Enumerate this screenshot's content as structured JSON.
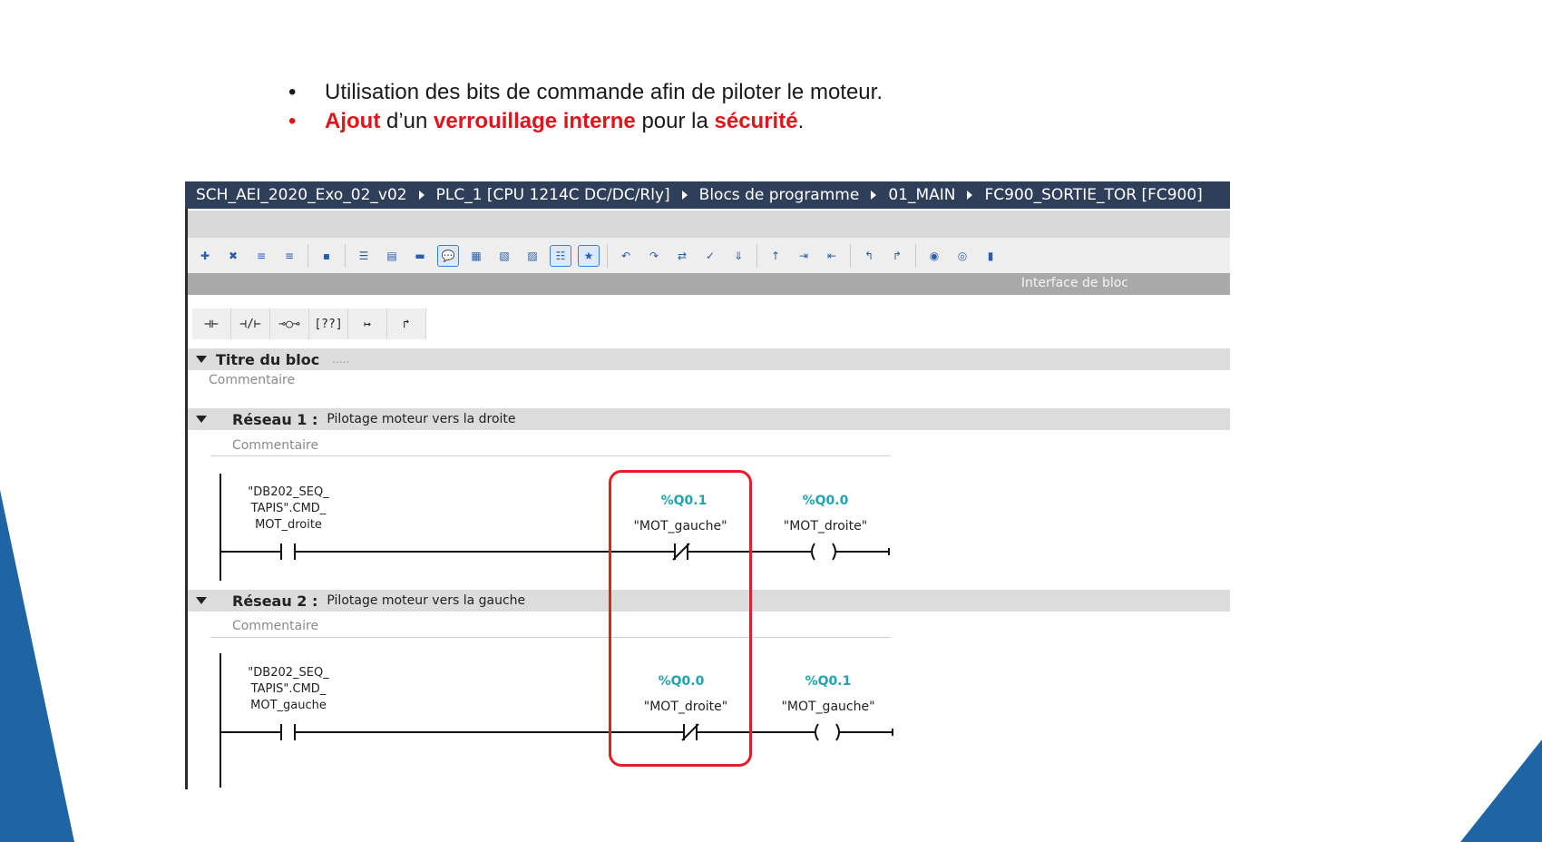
{
  "slide": {
    "bullet1": "Utilisation des bits de commande afin de piloter le moteur.",
    "bullet2": {
      "w1": "Ajout",
      "t1": "d’un",
      "w2": "verrouillage interne",
      "t2": "pour la",
      "w3": "sécurité",
      "t3": "."
    },
    "bullet_char": "•",
    "colors": {
      "highlight": "#e0141b",
      "decor": "#1f64a3"
    }
  },
  "breadcrumb": [
    "SCH_AEI_2020_Exo_02_v02",
    "PLC_1 [CPU 1214C DC/DC/Rly]",
    "Blocs de programme",
    "01_MAIN",
    "FC900_SORTIE_TOR [FC900]"
  ],
  "interface_label": "Interface de bloc",
  "lad_tools": [
    "⊣⊢",
    "⊣/⊢",
    "⊸○⊸",
    "[??]",
    "↦",
    "↱"
  ],
  "block": {
    "title": "Titre du bloc",
    "dots": ".....",
    "comment": "Commentaire"
  },
  "networks": [
    {
      "label": "Réseau 1 :",
      "title": "Pilotage moteur vers la droite",
      "comment": "Commentaire",
      "contact_var": [
        "\"DB202_SEQ_",
        "TAPIS\".CMD_",
        "MOT_droite"
      ],
      "nc_addr": "%Q0.1",
      "nc_name": "\"MOT_gauche\"",
      "coil_addr": "%Q0.0",
      "coil_name": "\"MOT_droite\""
    },
    {
      "label": "Réseau 2 :",
      "title": "Pilotage moteur vers la gauche",
      "comment": "Commentaire",
      "contact_var": [
        "\"DB202_SEQ_",
        "TAPIS\".CMD_",
        "MOT_gauche"
      ],
      "nc_addr": "%Q0.0",
      "nc_name": "\"MOT_droite\"",
      "coil_addr": "%Q0.1",
      "coil_name": "\"MOT_gauche\""
    }
  ]
}
